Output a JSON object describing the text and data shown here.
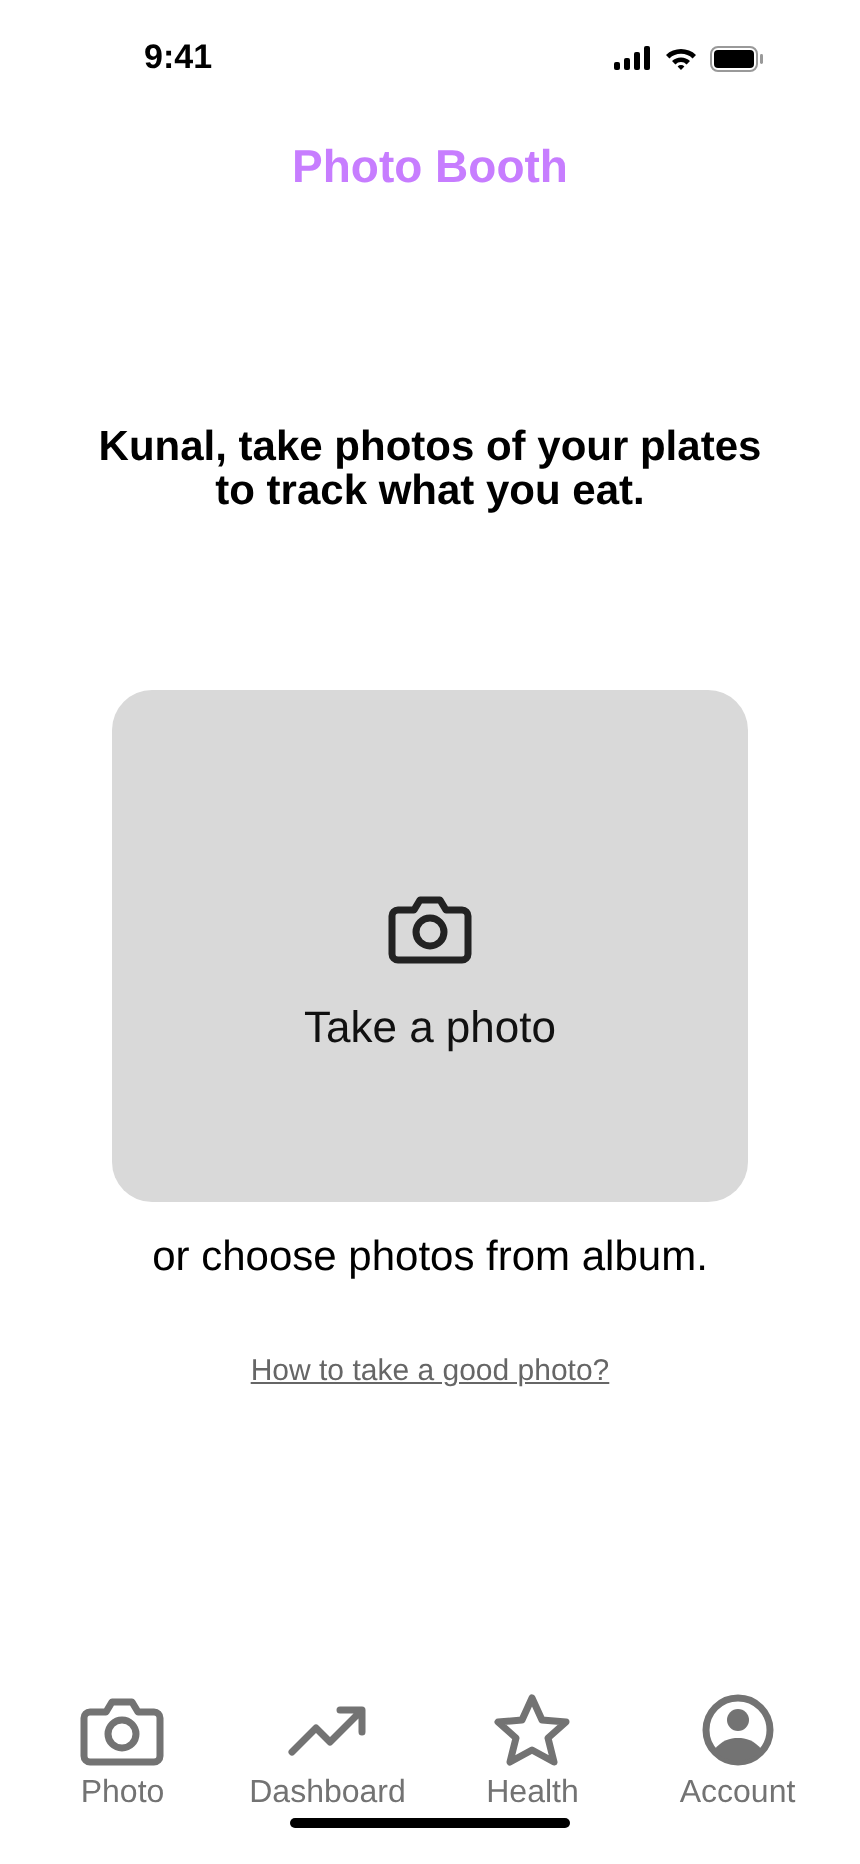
{
  "status_bar": {
    "time": "9:41"
  },
  "header": {
    "title": "Photo Booth"
  },
  "prompt": "Kunal, take photos of your plates to track what you eat.",
  "capture": {
    "label": "Take a photo"
  },
  "album_text": "or choose photos from album.",
  "help_link": "How to take a good photo?",
  "tab_bar": [
    {
      "kind": "camera",
      "label": "Photo",
      "selected": false
    },
    {
      "kind": "trend",
      "label": "Dashboard",
      "selected": false
    },
    {
      "kind": "star",
      "label": "Health",
      "selected": false
    },
    {
      "kind": "account",
      "label": "Account",
      "selected": false
    }
  ]
}
